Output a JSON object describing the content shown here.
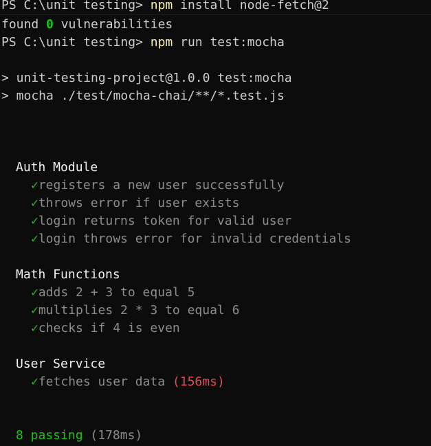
{
  "lines": {
    "cmd1": {
      "prompt": "PS C:\\unit testing> ",
      "program": "npm",
      "args": " install node-fetch@2"
    },
    "audit": {
      "pre": "found ",
      "count": "0",
      "post": " vulnerabilities"
    },
    "cmd2": {
      "prompt": "PS C:\\unit testing> ",
      "program": "npm",
      "args": " run test:mocha"
    },
    "script1": "> unit-testing-project@1.0.0 test:mocha",
    "script2": "> mocha ./test/mocha-chai/**/*.test.js"
  },
  "check_mark": "✓",
  "suites": [
    {
      "name": "Auth Module",
      "tests": [
        {
          "title": "registers a new user successfully"
        },
        {
          "title": "throws error if user exists"
        },
        {
          "title": "login returns token for valid user"
        },
        {
          "title": "login throws error for invalid credentials"
        }
      ]
    },
    {
      "name": "Math Functions",
      "tests": [
        {
          "title": "adds 2 + 3 to equal 5"
        },
        {
          "title": "multiplies 2 * 3 to equal 6"
        },
        {
          "title": "checks if 4 is even"
        }
      ]
    },
    {
      "name": "User Service",
      "tests": [
        {
          "title": "fetches user data",
          "duration": "(156ms)"
        }
      ]
    }
  ],
  "summary": {
    "passing": "8 passing",
    "duration": "(178ms)"
  },
  "colors": {
    "background": "#0c0c0c",
    "text": "#cccccc",
    "command": "#f9f1a5",
    "pass": "#16c60c",
    "slow": "#e74856",
    "test_title": "#8c8c8c"
  }
}
